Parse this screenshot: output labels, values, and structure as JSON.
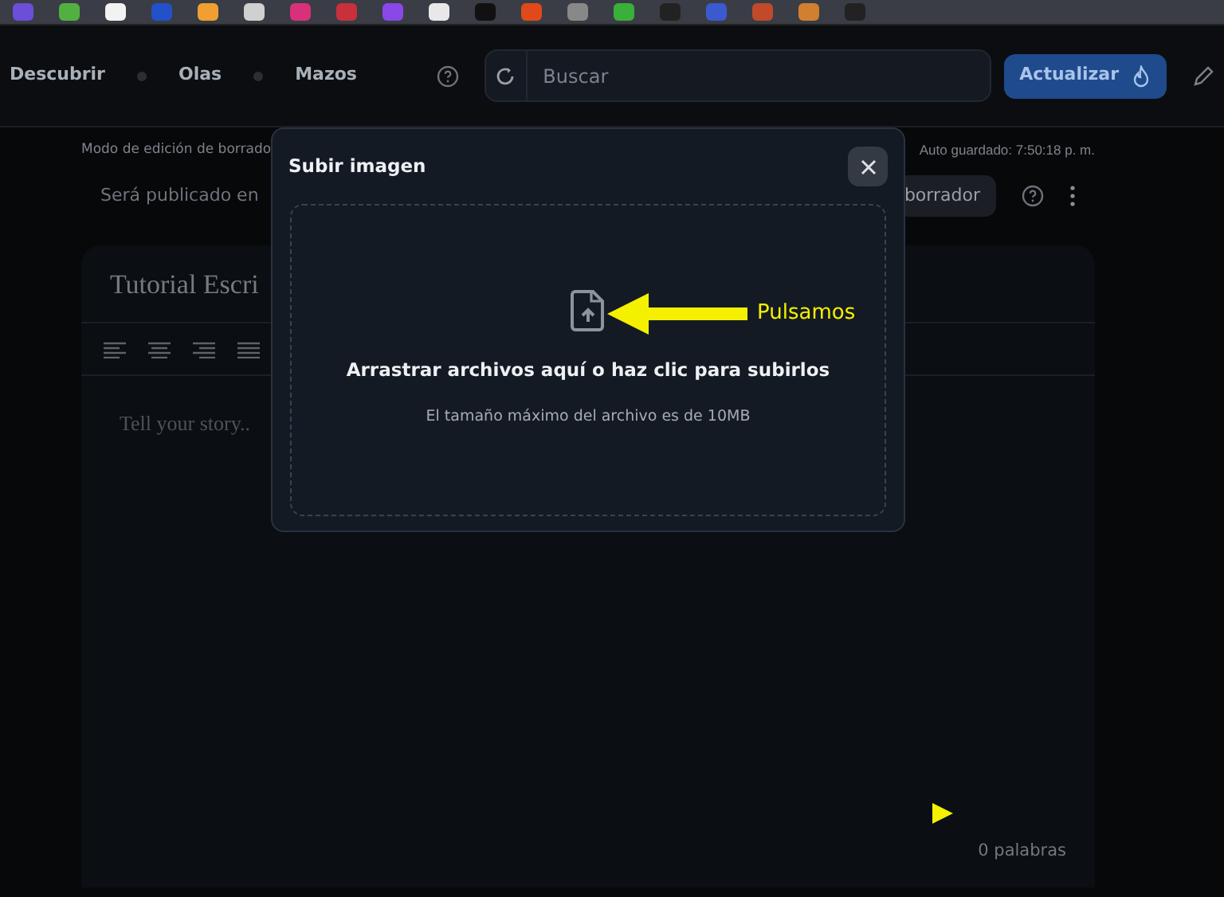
{
  "nav": {
    "items": [
      {
        "label": "Descubrir"
      },
      {
        "label": "Olas"
      },
      {
        "label": "Mazos"
      }
    ],
    "search": {
      "placeholder": "Buscar"
    },
    "update_button": "Actualizar"
  },
  "editor": {
    "mode_text": "Modo de edición de borrado",
    "autosave": "Auto guardado: 7:50:18 p. m.",
    "publish_label": "Será publicado en",
    "draft_button": "borrador",
    "title": "Tutorial Escri",
    "body_placeholder": "Tell your story..",
    "word_count": "0 palabras"
  },
  "modal": {
    "title": "Subir imagen",
    "drop_text": "Arrastrar archivos aquí o haz clic para subirlos",
    "size_hint": "El tamaño máximo del archivo es de 10MB",
    "annotation": "Pulsamos"
  }
}
